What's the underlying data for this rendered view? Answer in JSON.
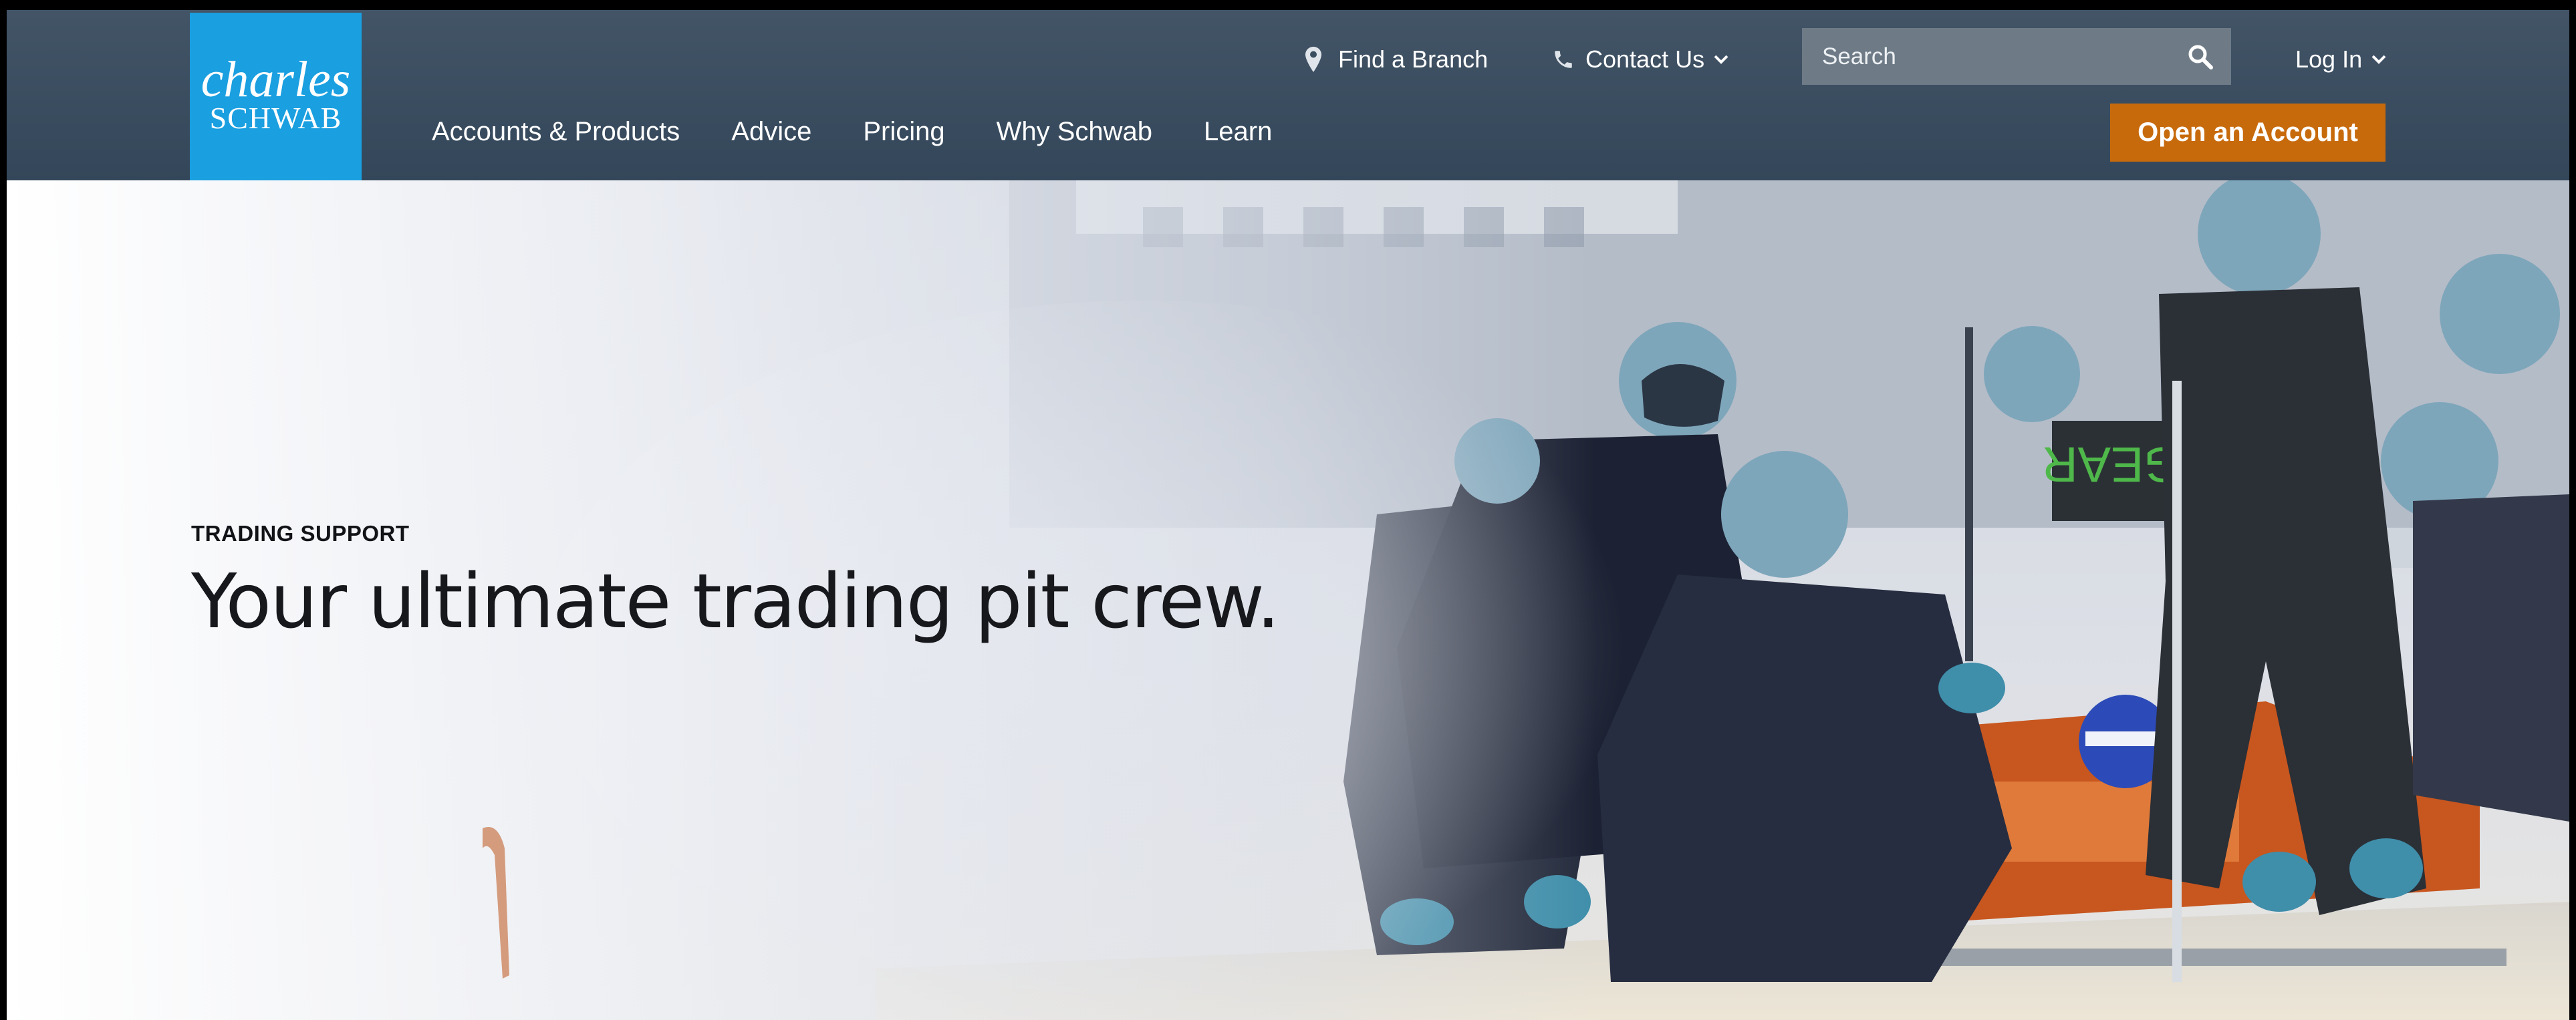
{
  "header": {
    "logo": {
      "line1": "charles",
      "line2": "SCHWAB"
    },
    "utility_nav": {
      "find_branch": "Find a Branch",
      "contact_us": "Contact Us",
      "log_in": "Log In"
    },
    "search": {
      "placeholder": "Search"
    },
    "main_nav": [
      "Accounts & Products",
      "Advice",
      "Pricing",
      "Why Schwab",
      "Learn"
    ],
    "cta_label": "Open an Account",
    "colors": {
      "header_bg": "#3b4e60",
      "logo_bg": "#1a9fe0",
      "cta_bg": "#c76a0c"
    }
  },
  "hero": {
    "eyebrow": "TRADING SUPPORT",
    "headline": "Your ultimate trading pit crew.",
    "image_subject": "pit-crew-photo"
  }
}
